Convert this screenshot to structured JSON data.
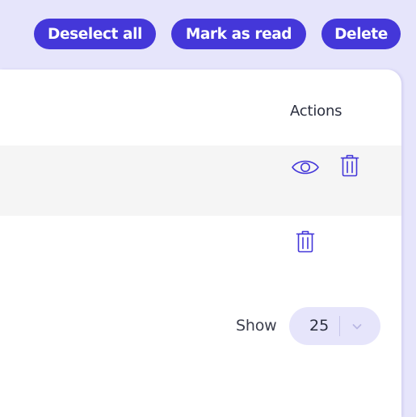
{
  "toolbar": {
    "deselect_all_label": "Deselect all",
    "mark_as_read_label": "Mark as read",
    "delete_label": "Delete"
  },
  "table": {
    "actions_header": "Actions",
    "rows": [
      {
        "actions": [
          "view-icon",
          "trash-icon"
        ]
      },
      {
        "actions": [
          "trash-icon"
        ]
      }
    ]
  },
  "pagination": {
    "show_label": "Show",
    "page_size": "25",
    "dropdown_icon": "chevron-down-icon"
  },
  "colors": {
    "accent": "#4437d9",
    "background": "#e6e5fb",
    "row_alt": "#f5f5f5",
    "chevron": "#b9b7e4"
  }
}
